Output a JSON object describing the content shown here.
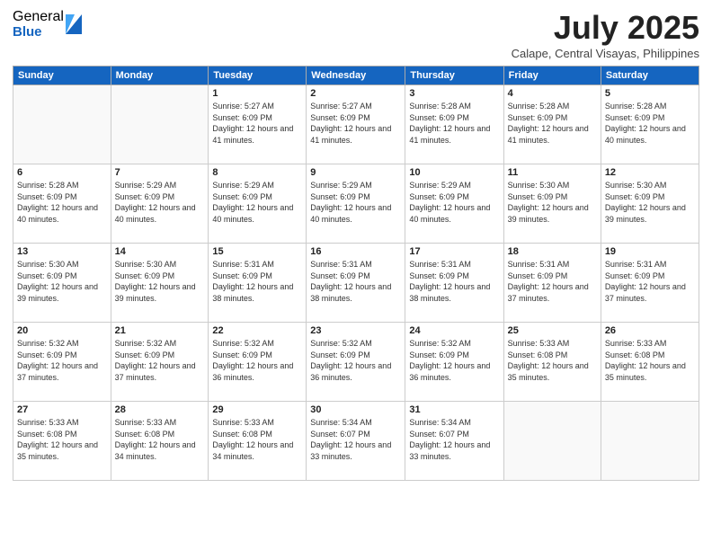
{
  "logo": {
    "general": "General",
    "blue": "Blue"
  },
  "title": "July 2025",
  "location": "Calape, Central Visayas, Philippines",
  "days_header": [
    "Sunday",
    "Monday",
    "Tuesday",
    "Wednesday",
    "Thursday",
    "Friday",
    "Saturday"
  ],
  "weeks": [
    [
      {
        "day": "",
        "info": ""
      },
      {
        "day": "",
        "info": ""
      },
      {
        "day": "1",
        "info": "Sunrise: 5:27 AM\nSunset: 6:09 PM\nDaylight: 12 hours and 41 minutes."
      },
      {
        "day": "2",
        "info": "Sunrise: 5:27 AM\nSunset: 6:09 PM\nDaylight: 12 hours and 41 minutes."
      },
      {
        "day": "3",
        "info": "Sunrise: 5:28 AM\nSunset: 6:09 PM\nDaylight: 12 hours and 41 minutes."
      },
      {
        "day": "4",
        "info": "Sunrise: 5:28 AM\nSunset: 6:09 PM\nDaylight: 12 hours and 41 minutes."
      },
      {
        "day": "5",
        "info": "Sunrise: 5:28 AM\nSunset: 6:09 PM\nDaylight: 12 hours and 40 minutes."
      }
    ],
    [
      {
        "day": "6",
        "info": "Sunrise: 5:28 AM\nSunset: 6:09 PM\nDaylight: 12 hours and 40 minutes."
      },
      {
        "day": "7",
        "info": "Sunrise: 5:29 AM\nSunset: 6:09 PM\nDaylight: 12 hours and 40 minutes."
      },
      {
        "day": "8",
        "info": "Sunrise: 5:29 AM\nSunset: 6:09 PM\nDaylight: 12 hours and 40 minutes."
      },
      {
        "day": "9",
        "info": "Sunrise: 5:29 AM\nSunset: 6:09 PM\nDaylight: 12 hours and 40 minutes."
      },
      {
        "day": "10",
        "info": "Sunrise: 5:29 AM\nSunset: 6:09 PM\nDaylight: 12 hours and 40 minutes."
      },
      {
        "day": "11",
        "info": "Sunrise: 5:30 AM\nSunset: 6:09 PM\nDaylight: 12 hours and 39 minutes."
      },
      {
        "day": "12",
        "info": "Sunrise: 5:30 AM\nSunset: 6:09 PM\nDaylight: 12 hours and 39 minutes."
      }
    ],
    [
      {
        "day": "13",
        "info": "Sunrise: 5:30 AM\nSunset: 6:09 PM\nDaylight: 12 hours and 39 minutes."
      },
      {
        "day": "14",
        "info": "Sunrise: 5:30 AM\nSunset: 6:09 PM\nDaylight: 12 hours and 39 minutes."
      },
      {
        "day": "15",
        "info": "Sunrise: 5:31 AM\nSunset: 6:09 PM\nDaylight: 12 hours and 38 minutes."
      },
      {
        "day": "16",
        "info": "Sunrise: 5:31 AM\nSunset: 6:09 PM\nDaylight: 12 hours and 38 minutes."
      },
      {
        "day": "17",
        "info": "Sunrise: 5:31 AM\nSunset: 6:09 PM\nDaylight: 12 hours and 38 minutes."
      },
      {
        "day": "18",
        "info": "Sunrise: 5:31 AM\nSunset: 6:09 PM\nDaylight: 12 hours and 37 minutes."
      },
      {
        "day": "19",
        "info": "Sunrise: 5:31 AM\nSunset: 6:09 PM\nDaylight: 12 hours and 37 minutes."
      }
    ],
    [
      {
        "day": "20",
        "info": "Sunrise: 5:32 AM\nSunset: 6:09 PM\nDaylight: 12 hours and 37 minutes."
      },
      {
        "day": "21",
        "info": "Sunrise: 5:32 AM\nSunset: 6:09 PM\nDaylight: 12 hours and 37 minutes."
      },
      {
        "day": "22",
        "info": "Sunrise: 5:32 AM\nSunset: 6:09 PM\nDaylight: 12 hours and 36 minutes."
      },
      {
        "day": "23",
        "info": "Sunrise: 5:32 AM\nSunset: 6:09 PM\nDaylight: 12 hours and 36 minutes."
      },
      {
        "day": "24",
        "info": "Sunrise: 5:32 AM\nSunset: 6:09 PM\nDaylight: 12 hours and 36 minutes."
      },
      {
        "day": "25",
        "info": "Sunrise: 5:33 AM\nSunset: 6:08 PM\nDaylight: 12 hours and 35 minutes."
      },
      {
        "day": "26",
        "info": "Sunrise: 5:33 AM\nSunset: 6:08 PM\nDaylight: 12 hours and 35 minutes."
      }
    ],
    [
      {
        "day": "27",
        "info": "Sunrise: 5:33 AM\nSunset: 6:08 PM\nDaylight: 12 hours and 35 minutes."
      },
      {
        "day": "28",
        "info": "Sunrise: 5:33 AM\nSunset: 6:08 PM\nDaylight: 12 hours and 34 minutes."
      },
      {
        "day": "29",
        "info": "Sunrise: 5:33 AM\nSunset: 6:08 PM\nDaylight: 12 hours and 34 minutes."
      },
      {
        "day": "30",
        "info": "Sunrise: 5:34 AM\nSunset: 6:07 PM\nDaylight: 12 hours and 33 minutes."
      },
      {
        "day": "31",
        "info": "Sunrise: 5:34 AM\nSunset: 6:07 PM\nDaylight: 12 hours and 33 minutes."
      },
      {
        "day": "",
        "info": ""
      },
      {
        "day": "",
        "info": ""
      }
    ]
  ]
}
